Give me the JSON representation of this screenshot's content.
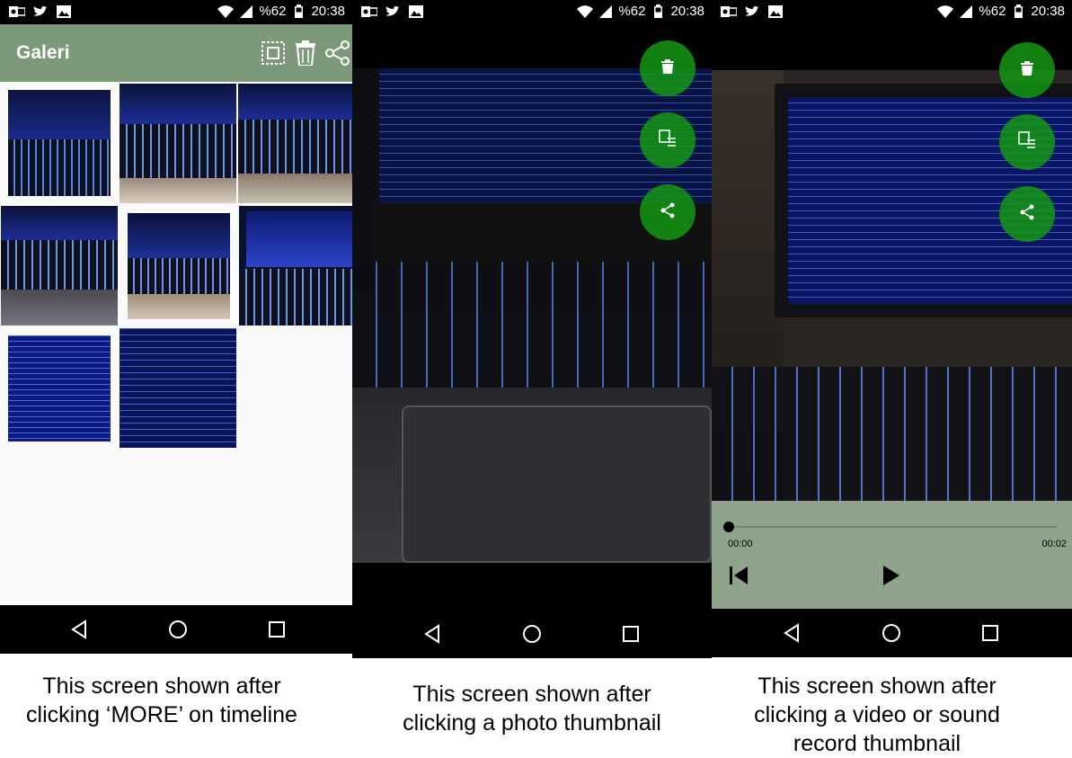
{
  "status_bar": {
    "battery": "%62",
    "time": "20:38",
    "notification_icons": [
      "outlook-icon",
      "twitter-icon",
      "image-icon"
    ],
    "system_icons": [
      "wifi-icon",
      "signal-icon",
      "battery-icon"
    ]
  },
  "gallery": {
    "title": "Galeri",
    "actions": [
      "select-all-icon",
      "trash-icon",
      "share-icon"
    ],
    "thumbnail_count": 8
  },
  "nav": {
    "buttons": [
      "back",
      "home",
      "recents"
    ]
  },
  "photo_viewer": {
    "fab_actions": [
      "trash-icon",
      "details-icon",
      "share-icon"
    ]
  },
  "media_viewer": {
    "fab_actions": [
      "trash-icon",
      "details-icon",
      "share-icon"
    ],
    "current_time": "00:00",
    "duration": "00:02",
    "progress": 0
  },
  "captions": {
    "panel1": [
      "This screen shown after",
      "clicking ‘MORE’ on timeline"
    ],
    "panel2": [
      "This screen shown after",
      "clicking a photo thumbnail"
    ],
    "panel3": [
      "This screen shown after",
      "clicking a video or sound",
      "record thumbnail"
    ]
  },
  "colors": {
    "appbar": "#7c9a7a",
    "fab": "#149614",
    "player": "#8ea58b"
  }
}
